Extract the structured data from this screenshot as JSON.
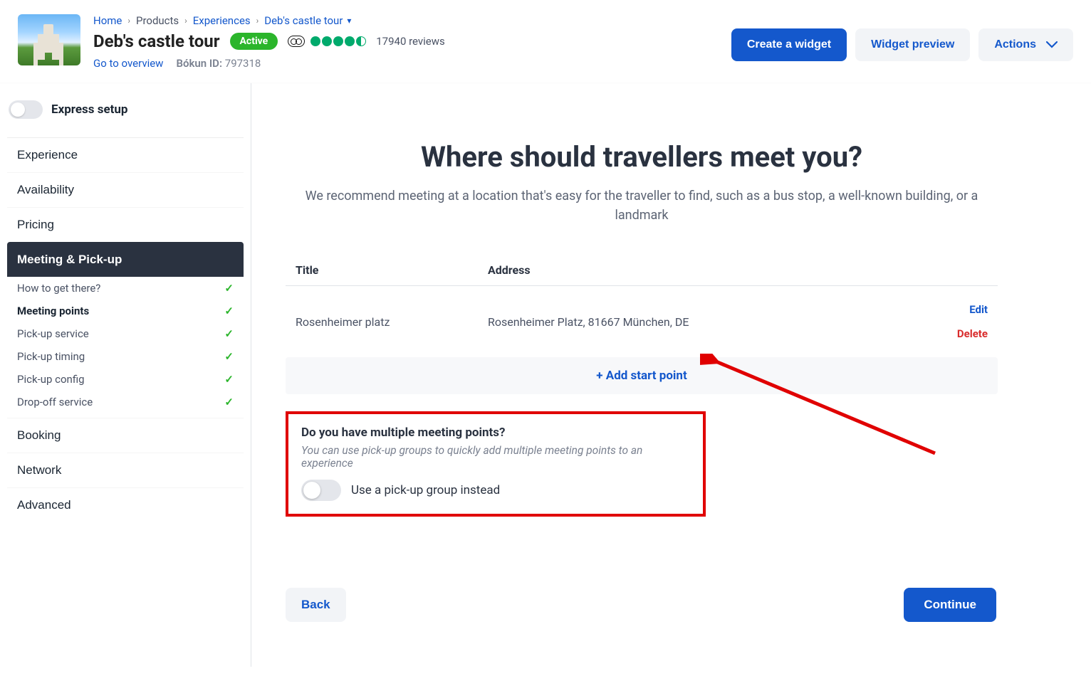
{
  "breadcrumbs": {
    "home": "Home",
    "products": "Products",
    "experiences": "Experiences",
    "current": "Deb's castle tour"
  },
  "product": {
    "title": "Deb's castle tour",
    "status": "Active",
    "review_count": "17940 reviews",
    "overview_link": "Go to overview",
    "bokun_id_label": "Bókun ID:",
    "bokun_id": "797318"
  },
  "header_actions": {
    "create_widget": "Create a widget",
    "widget_preview": "Widget preview",
    "actions": "Actions"
  },
  "sidebar": {
    "express_label": "Express setup",
    "items": {
      "experience": "Experience",
      "availability": "Availability",
      "pricing": "Pricing",
      "meeting_pickup": "Meeting & Pick-up",
      "booking": "Booking",
      "network": "Network",
      "advanced": "Advanced"
    },
    "sub_items": {
      "how_to_get_there": "How to get there?",
      "meeting_points": "Meeting points",
      "pickup_service": "Pick-up service",
      "pickup_timing": "Pick-up timing",
      "pickup_config": "Pick-up config",
      "dropoff_service": "Drop-off service"
    }
  },
  "main": {
    "heading": "Where should travellers meet you?",
    "subheading": "We recommend meeting at a location that's easy for the traveller to find, such as a bus stop, a well-known building, or a landmark",
    "table": {
      "col_title": "Title",
      "col_address": "Address",
      "rows": [
        {
          "title": "Rosenheimer platz",
          "address": "Rosenheimer Platz, 81667 München, DE"
        }
      ],
      "edit": "Edit",
      "delete": "Delete",
      "add": "+ Add start point"
    },
    "multiple": {
      "question": "Do you have multiple meeting points?",
      "hint": "You can use pick-up groups to quickly add multiple meeting points to an experience",
      "toggle_label": "Use a pick-up group instead"
    },
    "back": "Back",
    "continue": "Continue"
  }
}
